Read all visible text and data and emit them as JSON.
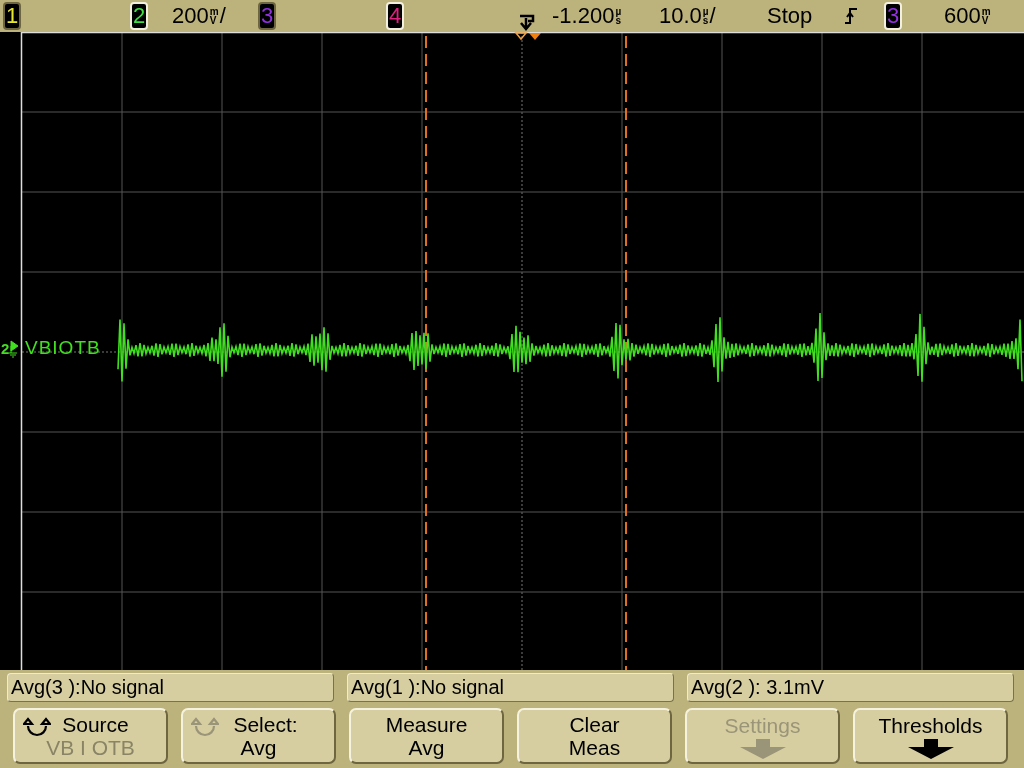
{
  "top_bar": {
    "channels": [
      {
        "label": "1",
        "highlighted": false
      },
      {
        "label": "2",
        "highlighted": true
      },
      {
        "label": "3",
        "highlighted": false
      },
      {
        "label": "4",
        "highlighted": true
      }
    ],
    "channel_scale": {
      "value": "200",
      "unit_top": "m",
      "unit_bottom": "V",
      "suffix": "/"
    },
    "delay": {
      "value": "-1.200",
      "unit_top": "µ",
      "unit_bottom": "s"
    },
    "timebase": {
      "value": "10.0",
      "unit_top": "µ",
      "unit_bottom": "s",
      "suffix": "/"
    },
    "run_state": "Stop",
    "trigger_source": {
      "label": "3",
      "highlighted": true
    },
    "trigger_level": {
      "value": "600",
      "unit_top": "m",
      "unit_bottom": "V"
    }
  },
  "screen": {
    "channel_marker": "2",
    "trace_label": "VBIOTB"
  },
  "measurements": [
    "Avg(3 ):No signal",
    "Avg(1 ):No signal",
    "Avg(2 ): 3.1mV"
  ],
  "softkeys": [
    {
      "kind": "rotary",
      "title": "Source",
      "value": "VB I OTB",
      "knob_enabled": true,
      "disabled": false
    },
    {
      "kind": "rotary",
      "title": "Select:",
      "value": "Avg",
      "knob_enabled": false,
      "disabled": false
    },
    {
      "kind": "text",
      "title": "Measure",
      "value": "Avg",
      "disabled": false
    },
    {
      "kind": "text",
      "title": "Clear",
      "value": "Meas",
      "disabled": false
    },
    {
      "kind": "submenu",
      "title": "Settings",
      "disabled": true
    },
    {
      "kind": "submenu",
      "title": "Thresholds",
      "disabled": false
    }
  ]
}
